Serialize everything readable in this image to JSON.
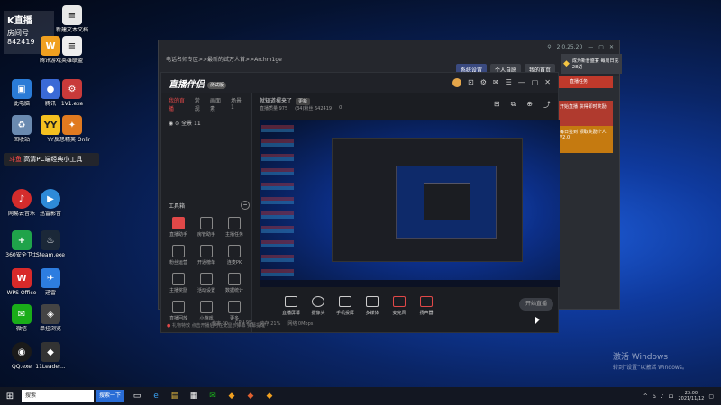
{
  "desktop": {
    "badge": {
      "title": "K直播",
      "room_label": "房间号",
      "room_number": "842419"
    },
    "icons": [
      {
        "label": "此电脑",
        "name": "computer"
      },
      {
        "label": "回收站",
        "name": "recycle-bin"
      },
      {
        "label": "腾讯",
        "name": "app"
      },
      {
        "label": "网易云音乐",
        "name": "music"
      },
      {
        "label": "360安全卫士",
        "name": "security"
      },
      {
        "label": "WPS Office",
        "name": "wps"
      },
      {
        "label": "微信",
        "name": "wechat"
      },
      {
        "label": "QQ.exe",
        "name": "qq"
      },
      {
        "label": "YY",
        "name": "yy"
      },
      {
        "label": "迅雷影音",
        "name": "player"
      },
      {
        "label": "Steam.exe",
        "name": "steam"
      },
      {
        "label": "迅雷",
        "name": "thunder"
      },
      {
        "label": "单挂浏览",
        "name": "browser"
      },
      {
        "label": "11Leader...",
        "name": "leader"
      },
      {
        "label": "腾讯游戏",
        "name": "game"
      },
      {
        "label": "新建文本文档",
        "name": "txt"
      },
      {
        "label": "1V1.exe",
        "name": "exe"
      },
      {
        "label": "英雄联盟",
        "name": "lol"
      },
      {
        "label": "反恐精英 Online",
        "name": "cs"
      }
    ],
    "notification": {
      "prefix": "斗鱼",
      "text": "高清PC端经典小工具"
    }
  },
  "outer_window": {
    "title": "电话名师专区>>最新的试万人首>>Archm1ge",
    "version": "2.0.25.20",
    "tabs": [
      "系统设置",
      "个人自愿",
      "我的首页"
    ],
    "promo": "成为新晋盛宴 每周日充28返",
    "red_button": "直播任务",
    "red_box": "开始直播 获得即时奖励",
    "gold_box": "每日签到 领取奖励个人 ¥2.0"
  },
  "app": {
    "logo": "直播伴侣",
    "logo_tag": "测试版",
    "side_tabs": [
      "我的直播",
      "常规",
      "画面素",
      "场景1"
    ],
    "scene": "全景 11",
    "tool_header": "工具箱",
    "tools": [
      {
        "label": "直播助手",
        "red": true
      },
      {
        "label": "房管助手",
        "red": false
      },
      {
        "label": "主播任务",
        "red": false
      },
      {
        "label": "粉丝运营",
        "red": false
      },
      {
        "label": "开通榜单",
        "red": false
      },
      {
        "label": "连麦PK",
        "red": false
      },
      {
        "label": "主播奖励",
        "red": false
      },
      {
        "label": "活动设置",
        "red": false
      },
      {
        "label": "数据统计",
        "red": false
      },
      {
        "label": "直播回放",
        "red": false
      },
      {
        "label": "小游戏",
        "red": false
      },
      {
        "label": "更多",
        "red": false
      }
    ],
    "footer": "礼物特效 点击开播后可在此显示弹幕 弹幕提醒",
    "main_title": "就知道摆来了",
    "main_tag": "更新",
    "stats": [
      "直播质量 975",
      "(34)粉丝 642419",
      "0"
    ],
    "controls": [
      "直播屏幕",
      "摄像头",
      "手机投屏",
      "多媒体",
      "麦克风",
      "扬声器"
    ],
    "start_button": "开始直播",
    "perf": [
      "帧率 30",
      "CPU 9%",
      "内存 21%",
      "网络 0Mbps"
    ]
  },
  "watermark": {
    "line1": "激活 Windows",
    "line2": "转到“设置”以激活 Windows。"
  },
  "taskbar": {
    "search_placeholder": "搜索",
    "search_button": "搜索一下",
    "time": "23:00",
    "date": "2021/11/12"
  }
}
